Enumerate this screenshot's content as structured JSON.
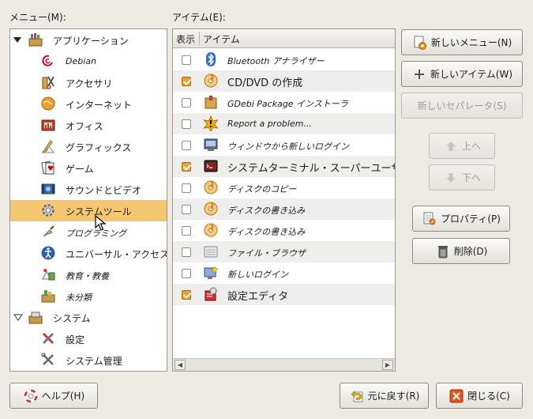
{
  "menu_label": "メニュー(M):",
  "items_label": "アイテム(E):",
  "menu_tree": [
    {
      "label": "アプリケーション",
      "level": 0,
      "expander": "filled",
      "icon": "applications-icon"
    },
    {
      "label": "Debian",
      "level": 1,
      "italic": true,
      "icon": "debian-swirl-icon"
    },
    {
      "label": "アクセサリ",
      "level": 1,
      "icon": "accessories-icon"
    },
    {
      "label": "インターネット",
      "level": 1,
      "icon": "internet-globe-icon"
    },
    {
      "label": "オフィス",
      "level": 1,
      "icon": "office-icon"
    },
    {
      "label": "グラフィックス",
      "level": 1,
      "icon": "graphics-icon"
    },
    {
      "label": "ゲーム",
      "level": 1,
      "icon": "games-cards-icon"
    },
    {
      "label": "サウンドとビデオ",
      "level": 1,
      "icon": "sound-video-icon"
    },
    {
      "label": "システムツール",
      "level": 1,
      "icon": "system-tools-gear-icon",
      "selected": true
    },
    {
      "label": "プログラミング",
      "level": 1,
      "italic": true,
      "icon": "programming-trowel-icon"
    },
    {
      "label": "ユニバーサル・アクセス",
      "level": 1,
      "icon": "universal-access-icon"
    },
    {
      "label": "教育・教養",
      "level": 1,
      "italic": true,
      "icon": "education-icon"
    },
    {
      "label": "未分類",
      "level": 1,
      "italic": true,
      "icon": "other-icon"
    },
    {
      "label": "システム",
      "level": 0,
      "expander": "outline",
      "icon": "system-icon"
    },
    {
      "label": "設定",
      "level": 1,
      "icon": "preferences-icon"
    },
    {
      "label": "システム管理",
      "level": 1,
      "icon": "administration-icon"
    }
  ],
  "list_header": {
    "show": "表示",
    "item": "アイテム"
  },
  "items": [
    {
      "label": "Bluetooth アナライザー",
      "checked": false,
      "italic": true,
      "icon": "bluetooth-icon"
    },
    {
      "label": "CD/DVD の作成",
      "checked": true,
      "italic": false,
      "icon": "disc-burner-icon"
    },
    {
      "label": "GDebi Package インストーラ",
      "checked": false,
      "italic": true,
      "icon": "package-installer-icon"
    },
    {
      "label": "Report a problem...",
      "checked": false,
      "italic": true,
      "icon": "warning-icon"
    },
    {
      "label": "ウィンドウから新しいログイン",
      "checked": false,
      "italic": true,
      "icon": "nested-login-icon"
    },
    {
      "label": "システムターミナル・スーパーユーザ",
      "checked": true,
      "italic": false,
      "icon": "root-terminal-icon"
    },
    {
      "label": "ディスクのコピー",
      "checked": false,
      "italic": true,
      "icon": "disc-copy-icon"
    },
    {
      "label": "ディスクの書き込み",
      "checked": false,
      "italic": true,
      "icon": "disc-write-icon"
    },
    {
      "label": "ディスクの書き込み",
      "checked": false,
      "italic": true,
      "icon": "disc-write-icon"
    },
    {
      "label": "ファイル・ブラウザ",
      "checked": false,
      "italic": true,
      "icon": "file-browser-icon"
    },
    {
      "label": "新しいログイン",
      "checked": false,
      "italic": true,
      "icon": "new-login-icon"
    },
    {
      "label": "設定エディタ",
      "checked": true,
      "italic": false,
      "icon": "config-editor-icon"
    }
  ],
  "buttons": {
    "new_menu": "新しいメニュー(N)",
    "new_item": "新しいアイテム(W)",
    "new_separator": "新しいセパレータ(S)",
    "move_up": "上へ",
    "move_down": "下へ",
    "properties": "プロパティ(P)",
    "delete": "削除(D)",
    "help": "ヘルプ(H)",
    "revert": "元に戻す(R)",
    "close": "閉じる(C)"
  },
  "colors": {
    "selection": "#f4c66f",
    "check": "#f29e2a",
    "window_bg": "#ede9e3"
  }
}
